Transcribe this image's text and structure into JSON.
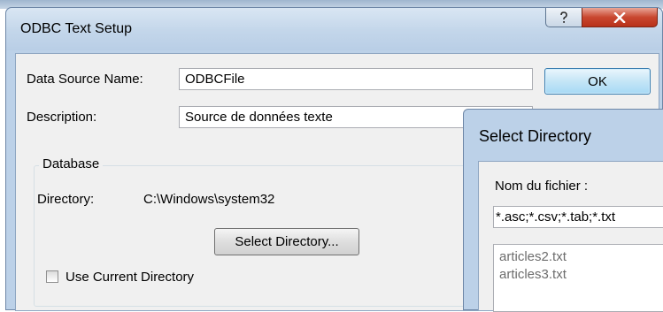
{
  "main_dialog": {
    "title": "ODBC Text Setup",
    "help_glyph": "?",
    "close_glyph": "X",
    "data_source_name": {
      "label": "Data Source Name:",
      "value": "ODBCFile"
    },
    "description": {
      "label": "Description:",
      "value": "Source de données texte"
    },
    "ok_label": "OK",
    "database": {
      "legend": "Database",
      "directory_label": "Directory:",
      "directory_value": "C:\\Windows\\system32",
      "select_directory_label": "Select Directory...",
      "use_current_label": "Use Current Directory",
      "use_current_checked": false
    }
  },
  "select_directory_dialog": {
    "title": "Select Directory",
    "filename_label": "Nom du fichier :",
    "filename_value": "*.asc;*.csv;*.tab;*.txt",
    "files": [
      "articles2.txt",
      "articles3.txt"
    ]
  },
  "colors": {
    "frame": "#bcd1e8",
    "close_button": "#c9472f",
    "ok_button_border": "#3c7fb1"
  },
  "icons": [
    "question-mark-icon",
    "close-x-icon"
  ]
}
